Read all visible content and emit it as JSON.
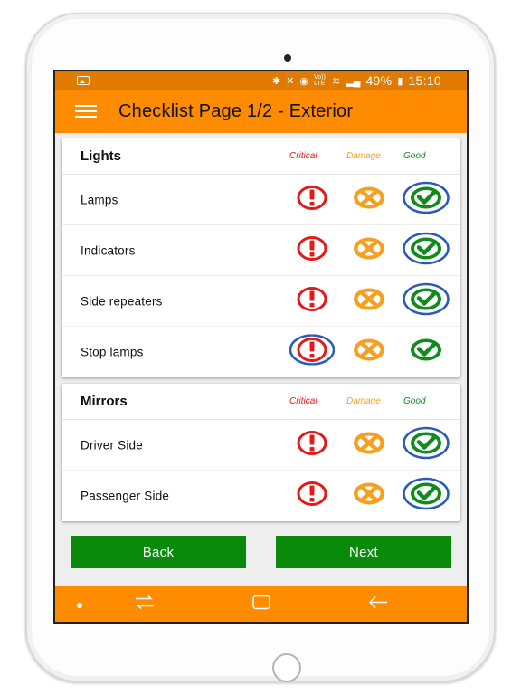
{
  "status_bar": {
    "battery": "49%",
    "time": "15:10",
    "network_label": "Vo)) LTE",
    "icons": [
      "image-icon",
      "bluetooth-icon",
      "mute-icon",
      "alarm-icon",
      "wifi-icon",
      "signal-icon",
      "battery-icon"
    ]
  },
  "app_bar": {
    "title": "Checklist Page 1/2 - Exterior",
    "menu_icon": "menu-icon"
  },
  "columns": {
    "critical": "Critical",
    "damage": "Damage",
    "good": "Good"
  },
  "sections": [
    {
      "title": "Lights",
      "items": [
        {
          "label": "Lamps",
          "selected": "good"
        },
        {
          "label": "Indicators",
          "selected": "good"
        },
        {
          "label": "Side repeaters",
          "selected": "good"
        },
        {
          "label": "Stop lamps",
          "selected": "critical"
        }
      ]
    },
    {
      "title": "Mirrors",
      "items": [
        {
          "label": "Driver Side",
          "selected": "good"
        },
        {
          "label": "Passenger Side",
          "selected": "good"
        }
      ]
    }
  ],
  "buttons": {
    "back": "Back",
    "next": "Next"
  },
  "nav_bar": {
    "items": [
      "dot-icon",
      "recent-apps-icon",
      "home-icon",
      "back-arrow-icon"
    ]
  },
  "colors": {
    "orange": "#ff8c00",
    "status_orange": "#e07a00",
    "critical": "#e21a1a",
    "damage": "#f5a020",
    "good": "#118a1e",
    "selected_ring": "#2a5bb8",
    "button_green": "#0a8a0a"
  }
}
